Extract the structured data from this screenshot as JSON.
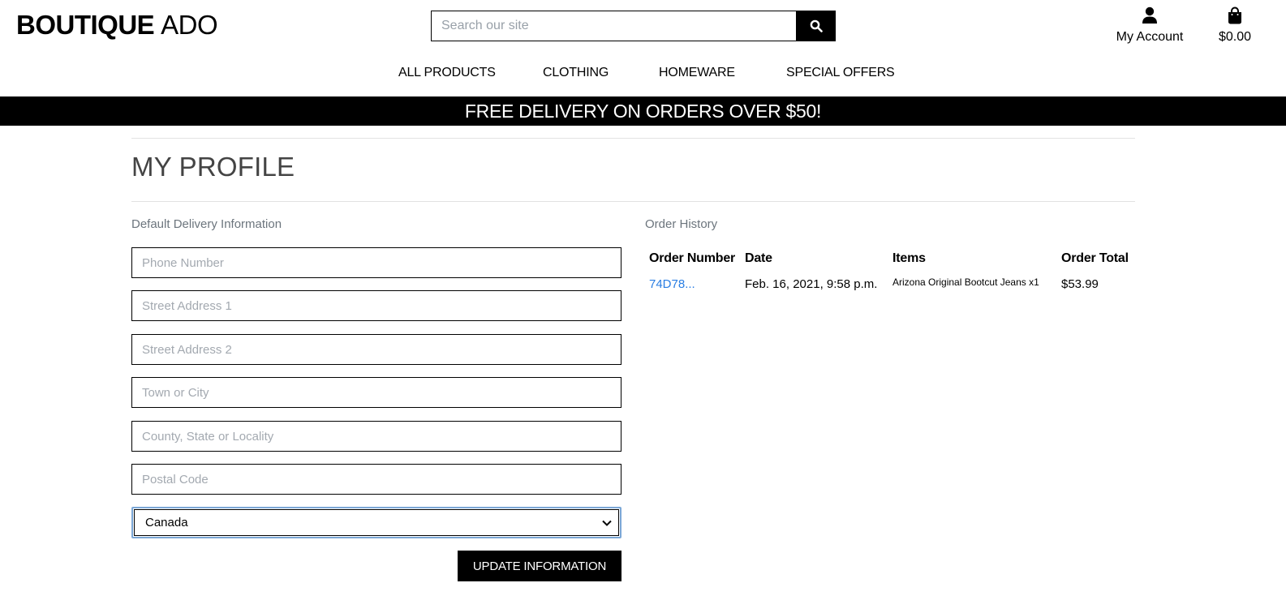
{
  "brand": {
    "name_bold": "BOUTIQUE",
    "name_regular": "ADO"
  },
  "search": {
    "placeholder": "Search our site",
    "icon": "search-icon"
  },
  "header": {
    "account_label": "My Account",
    "account_icon": "user-icon",
    "bag_total": "$0.00",
    "bag_icon": "shopping-bag-icon"
  },
  "nav": [
    {
      "label": "ALL PRODUCTS"
    },
    {
      "label": "CLOTHING"
    },
    {
      "label": "HOMEWARE"
    },
    {
      "label": "SPECIAL OFFERS"
    }
  ],
  "banner": {
    "text": "FREE DELIVERY ON ORDERS OVER $50!"
  },
  "page": {
    "title": "MY PROFILE"
  },
  "delivery": {
    "heading": "Default Delivery Information",
    "fields": [
      {
        "placeholder": "Phone Number",
        "value": ""
      },
      {
        "placeholder": "Street Address 1",
        "value": ""
      },
      {
        "placeholder": "Street Address 2",
        "value": ""
      },
      {
        "placeholder": "Town or City",
        "value": ""
      },
      {
        "placeholder": "County, State or Locality",
        "value": ""
      },
      {
        "placeholder": "Postal Code",
        "value": ""
      }
    ],
    "country": {
      "selected": "Canada"
    },
    "submit_label": "UPDATE INFORMATION"
  },
  "orders": {
    "heading": "Order History",
    "columns": [
      "Order Number",
      "Date",
      "Items",
      "Order Total"
    ],
    "rows": [
      {
        "number": "74D78...",
        "date": "Feb. 16, 2021, 9:58 p.m.",
        "items": "Arizona Original Bootcut Jeans x1",
        "total": "$53.99"
      }
    ]
  },
  "colors": {
    "brand": "#000000",
    "link": "#2a7ee3",
    "muted": "#6c757d"
  }
}
